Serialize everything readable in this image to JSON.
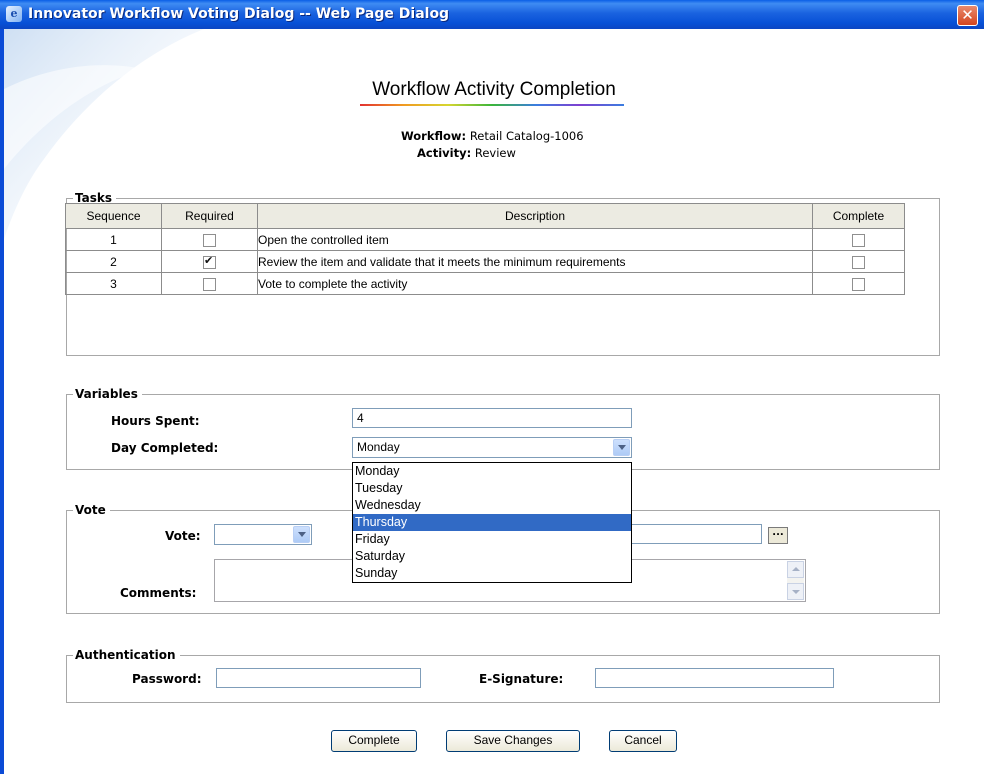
{
  "window": {
    "title": "Innovator Workflow Voting Dialog -- Web Page Dialog"
  },
  "page": {
    "heading": "Workflow Activity Completion"
  },
  "meta": {
    "workflow_label": "Workflow:",
    "workflow_value": "Retail Catalog-1006",
    "activity_label": "Activity:",
    "activity_value": "Review"
  },
  "tasks": {
    "legend": "Tasks",
    "columns": [
      "Sequence",
      "Required",
      "Description",
      "Complete"
    ],
    "rows": [
      {
        "sequence": "1",
        "required": false,
        "description": "Open the controlled item",
        "complete": false
      },
      {
        "sequence": "2",
        "required": true,
        "description": "Review the item and validate that it meets the minimum requirements",
        "complete": false
      },
      {
        "sequence": "3",
        "required": false,
        "description": "Vote to complete the activity",
        "complete": false
      }
    ]
  },
  "variables": {
    "legend": "Variables",
    "hours_label": "Hours Spent:",
    "hours_value": "4",
    "day_label": "Day Completed:",
    "day_value": "Monday",
    "day_options": [
      "Monday",
      "Tuesday",
      "Wednesday",
      "Thursday",
      "Friday",
      "Saturday",
      "Sunday"
    ],
    "highlighted_option": "Thursday"
  },
  "vote": {
    "legend": "Vote",
    "vote_label": "Vote:",
    "vote_value": "",
    "comments_label": "Comments:"
  },
  "authentication": {
    "legend": "Authentication",
    "password_label": "Password:",
    "esignature_label": "E-Signature:"
  },
  "buttons": {
    "complete": "Complete",
    "save": "Save Changes",
    "cancel": "Cancel"
  },
  "colors": {
    "titlebar": "#0a5ee6",
    "highlight": "#316ac5",
    "header_bg": "#ecebe2"
  }
}
